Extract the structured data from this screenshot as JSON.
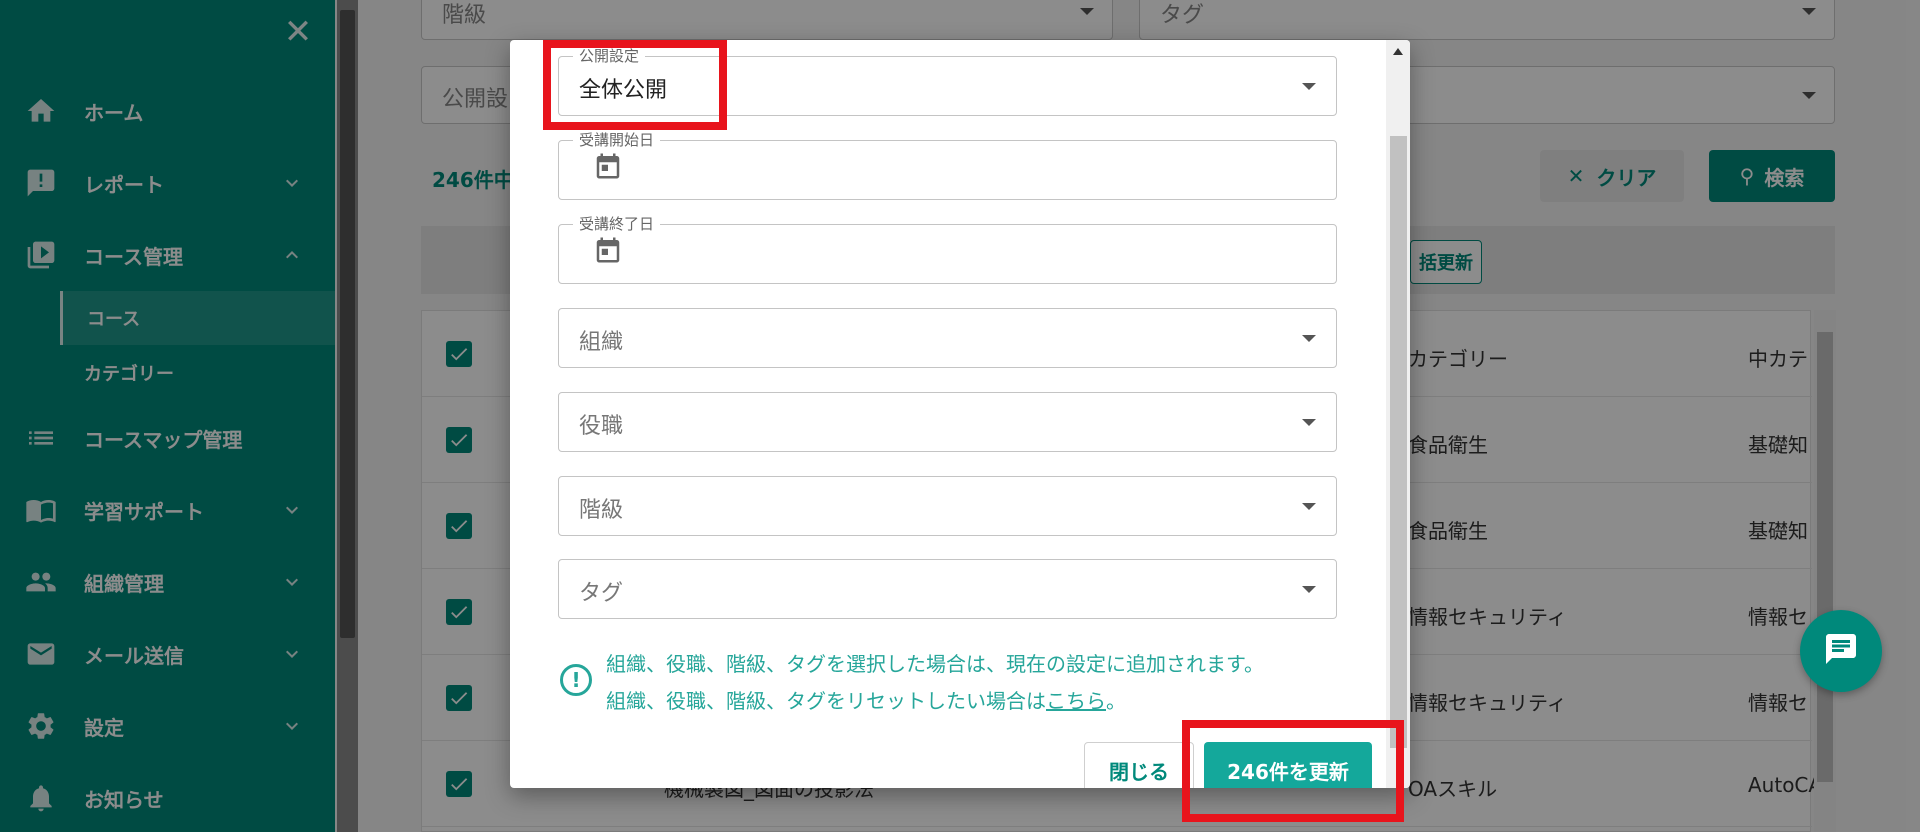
{
  "sidebar": {
    "items": [
      {
        "label": "ホーム",
        "icon": "home-icon"
      },
      {
        "label": "レポート",
        "icon": "report-icon"
      },
      {
        "label": "コース管理",
        "icon": "course-icon"
      },
      {
        "label": "コースマップ管理",
        "icon": "list-icon"
      },
      {
        "label": "学習サポート",
        "icon": "book-icon"
      },
      {
        "label": "組織管理",
        "icon": "people-icon"
      },
      {
        "label": "メール送信",
        "icon": "mail-icon"
      },
      {
        "label": "設定",
        "icon": "gear-icon"
      },
      {
        "label": "お知らせ",
        "icon": "bell-icon"
      }
    ],
    "sub_items": [
      {
        "label": "コース"
      },
      {
        "label": "カテゴリー"
      }
    ]
  },
  "background": {
    "filters": {
      "rank": "階級",
      "tag": "タグ",
      "public": "公開設"
    },
    "count_text": "246件中",
    "clear_label": "クリア",
    "search_label": "検索",
    "bulk_label": "括更新",
    "table": {
      "headers": [
        "カテゴリー",
        "中カテ"
      ],
      "rows": [
        {
          "category": "食品衛生",
          "sub": "基礎知"
        },
        {
          "category": "食品衛生",
          "sub": "基礎知"
        },
        {
          "category": "情報セキュリティ",
          "sub": "情報セ"
        },
        {
          "category": "情報セキュリティ",
          "sub": "情報セ"
        },
        {
          "name": "機械製図_図面の投影法",
          "category": "OAスキル",
          "sub": "AutoCA"
        }
      ]
    }
  },
  "dialog": {
    "public_setting": {
      "legend": "公開設定",
      "value": "全体公開"
    },
    "start_date": {
      "legend": "受講開始日"
    },
    "end_date": {
      "legend": "受講終了日"
    },
    "organization": {
      "placeholder": "組織"
    },
    "position": {
      "placeholder": "役職"
    },
    "rank": {
      "placeholder": "階級"
    },
    "tag": {
      "placeholder": "タグ"
    },
    "info_line1": "組織、役職、階級、タグを選択した場合は、現在の設定に追加されます。",
    "info_line2_prefix": "組織、役職、階級、タグをリセットしたい場合は",
    "info_link": "こちら",
    "info_line2_suffix": "。",
    "close_label": "閉じる",
    "update_label": "246件を更新"
  },
  "colors": {
    "sidebar": "#00897b",
    "accent": "#14a89b",
    "highlight": "#e8141c"
  }
}
